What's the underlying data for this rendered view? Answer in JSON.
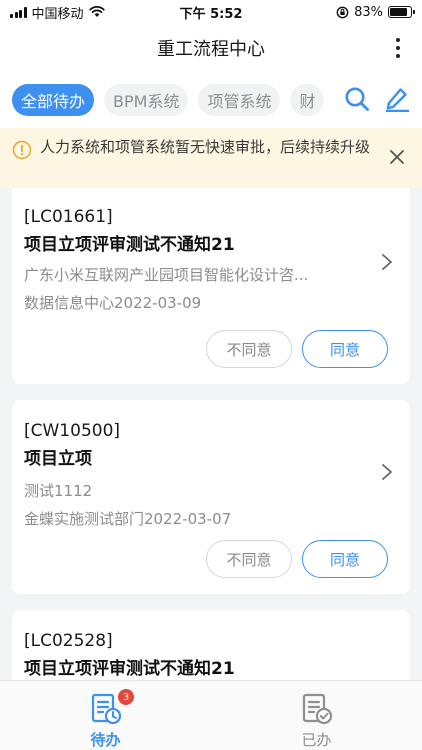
{
  "status_bar": {
    "carrier": "中国移动",
    "time": "下午 5:52",
    "battery_text": "83%",
    "battery_level": 0.83
  },
  "nav": {
    "title": "重工流程中心"
  },
  "tabs": [
    {
      "label": "全部待办",
      "active": true
    },
    {
      "label": "BPM系统",
      "active": false
    },
    {
      "label": "项管系统",
      "active": false
    },
    {
      "label": "财",
      "active": false
    }
  ],
  "notice": {
    "text": "人力系统和项管系统暂无快速审批，后续持续升级"
  },
  "cards": [
    {
      "code": "[LC01661]",
      "title": "项目立项评审测试不通知21",
      "subtitle": "广东小米互联网产业园项目智能化设计咨...",
      "dept_date": "数据信息中心2022-03-09",
      "reject_label": "不同意",
      "approve_label": "同意"
    },
    {
      "code": "[CW10500]",
      "title": "项目立项",
      "subtitle": "测试1112",
      "dept_date": "金蝶实施测试部门2022-03-07",
      "reject_label": "不同意",
      "approve_label": "同意"
    },
    {
      "code": "[LC02528]",
      "title": "项目立项评审测试不通知21"
    }
  ],
  "bottom_nav": {
    "pending_label": "待办",
    "pending_badge": "3",
    "done_label": "已办"
  },
  "colors": {
    "accent": "#3d8ff0",
    "badge": "#e1473b",
    "notice_bg": "#fdf6e3",
    "notice_icon": "#e8a82a"
  },
  "icons": {
    "search": "search-icon",
    "edit": "edit-icon",
    "info": "info-icon",
    "close": "close-icon",
    "chevron": "chevron-right-icon",
    "pending": "pending-list-icon",
    "done": "done-list-icon"
  }
}
